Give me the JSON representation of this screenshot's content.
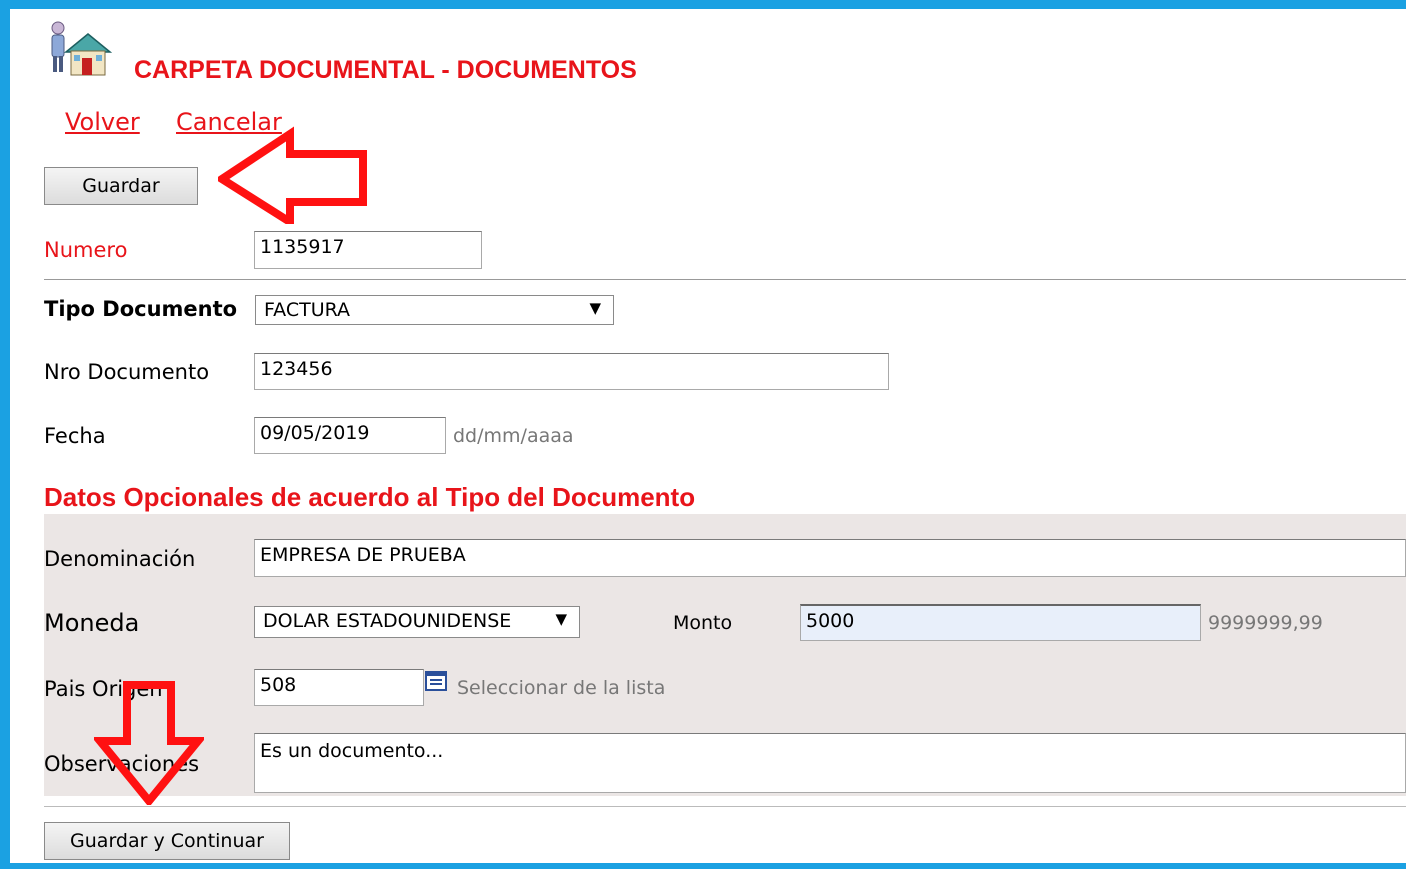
{
  "header": {
    "title": "CARPETA DOCUMENTAL - DOCUMENTOS",
    "icon": "house-user-icon"
  },
  "nav": {
    "back": "Volver",
    "cancel": "Cancelar"
  },
  "toolbar": {
    "save_label": "Guardar"
  },
  "form": {
    "numero": {
      "label": "Numero",
      "value": "1135917"
    },
    "tipo_documento": {
      "label": "Tipo Documento",
      "selected": "FACTURA"
    },
    "nro_documento": {
      "label": "Nro Documento",
      "value": "123456"
    },
    "fecha": {
      "label": "Fecha",
      "value": "09/05/2019",
      "format_hint": "dd/mm/aaaa"
    }
  },
  "optional": {
    "section_title": "Datos Opcionales de acuerdo al Tipo del Documento",
    "denominacion": {
      "label": "Denominación",
      "value": "EMPRESA DE PRUEBA"
    },
    "moneda": {
      "label": "Moneda",
      "selected": "DOLAR ESTADOUNIDENSE"
    },
    "monto": {
      "label": "Monto",
      "value": "5000",
      "format_hint": "9999999,99"
    },
    "pais_origen": {
      "label": "Pais Origen",
      "value": "508",
      "picker_hint": "Seleccionar de la lista"
    },
    "observaciones": {
      "label": "Observaciones",
      "value": "Es un documento..."
    }
  },
  "footer": {
    "save_continue_label": "Guardar y Continuar"
  },
  "colors": {
    "frame": "#1ba1e2",
    "accent": "#e8141a",
    "optional_background": "#ebe6e5",
    "monto_background": "#e8effa"
  }
}
